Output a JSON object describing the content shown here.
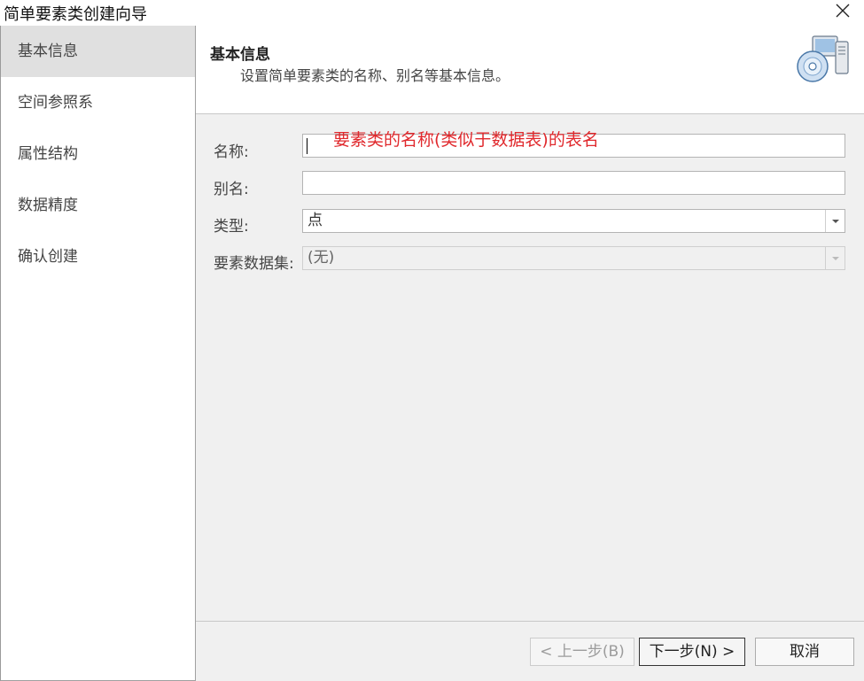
{
  "window": {
    "title": "简单要素类创建向导",
    "close_icon": "close-icon"
  },
  "sidebar": {
    "items": [
      {
        "label": "基本信息",
        "active": true
      },
      {
        "label": "空间参照系",
        "active": false
      },
      {
        "label": "属性结构",
        "active": false
      },
      {
        "label": "数据精度",
        "active": false
      },
      {
        "label": "确认创建",
        "active": false
      }
    ]
  },
  "header": {
    "title": "基本信息",
    "description": "设置简单要素类的名称、别名等基本信息。",
    "icon": "database-server-icon"
  },
  "form": {
    "name_label": "名称:",
    "name_value": "",
    "alias_label": "别名:",
    "alias_value": "",
    "type_label": "类型:",
    "type_value": "点",
    "dataset_label": "要素数据集:",
    "dataset_value": "(无)"
  },
  "annotation": {
    "text": "要素类的名称(类似于数据表)的表名",
    "color": "#e0282c"
  },
  "footer": {
    "prev_label": "< 上一步(B)",
    "next_label": "下一步(N) >",
    "cancel_label": "取消"
  }
}
